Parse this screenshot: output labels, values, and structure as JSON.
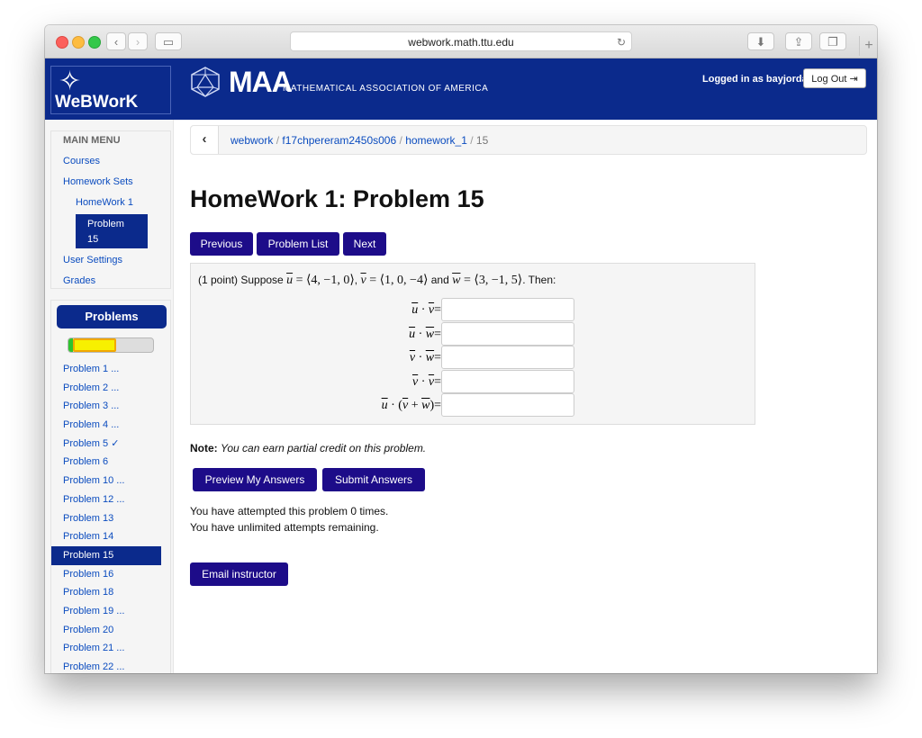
{
  "browser": {
    "url": "webwork.math.ttu.edu"
  },
  "header": {
    "logo_text": "WeBWorK",
    "maa_text": "MAA",
    "maa_sub": "MATHEMATICAL ASSOCIATION OF AMERICA",
    "logged_in": "Logged in as bayjorda.",
    "logout_label": "Log Out"
  },
  "sidebar": {
    "menu_title": "MAIN MENU",
    "courses": "Courses",
    "homework_sets": "Homework Sets",
    "homework1": "HomeWork 1",
    "active_problem": [
      "Problem",
      "15"
    ],
    "user_settings": "User Settings",
    "grades": "Grades",
    "problems_title": "Problems",
    "progress": {
      "correct_fraction": 0.05,
      "partial_fraction": 0.5
    },
    "problems": [
      "Problem 1 ...",
      "Problem 2 ...",
      "Problem 3 ...",
      "Problem 4 ...",
      "Problem 5 ✓",
      "Problem 6",
      "Problem 10 ...",
      "Problem 12 ...",
      "Problem 13",
      "Problem 14",
      "Problem 15",
      "Problem 16",
      "Problem 18",
      "Problem 19 ...",
      "Problem 20",
      "Problem 21 ...",
      "Problem 22 ..."
    ],
    "active_index": 10
  },
  "breadcrumb": {
    "items": [
      "webwork",
      "f17chpereram2450s006",
      "homework_1"
    ],
    "current": "15",
    "separator": "/"
  },
  "page_title": "HomeWork 1: Problem 15",
  "nav": {
    "previous": "Previous",
    "list": "Problem List",
    "next": "Next"
  },
  "problem": {
    "points": "(1 point) Suppose",
    "u_def": "u = ⟨4, −1, 0⟩",
    "v_def": "v = ⟨1, 0, −4⟩",
    "w_def": "w = ⟨3, −1, 5⟩",
    "and": "and",
    "then": ". Then:",
    "questions": [
      {
        "a": "u",
        "b": "v"
      },
      {
        "a": "u",
        "b": "w"
      },
      {
        "a": "v",
        "b": "w"
      },
      {
        "a": "v",
        "b": "v"
      },
      {
        "a": "u",
        "b": "v + w"
      }
    ],
    "values": [
      "",
      "",
      "",
      "",
      ""
    ]
  },
  "note": {
    "label": "Note:",
    "text": "You can earn partial credit on this problem."
  },
  "actions": {
    "preview": "Preview My Answers",
    "submit": "Submit Answers"
  },
  "attempts": {
    "line1": "You have attempted this problem 0 times.",
    "line2": "You have unlimited attempts remaining."
  },
  "email_label": "Email instructor"
}
